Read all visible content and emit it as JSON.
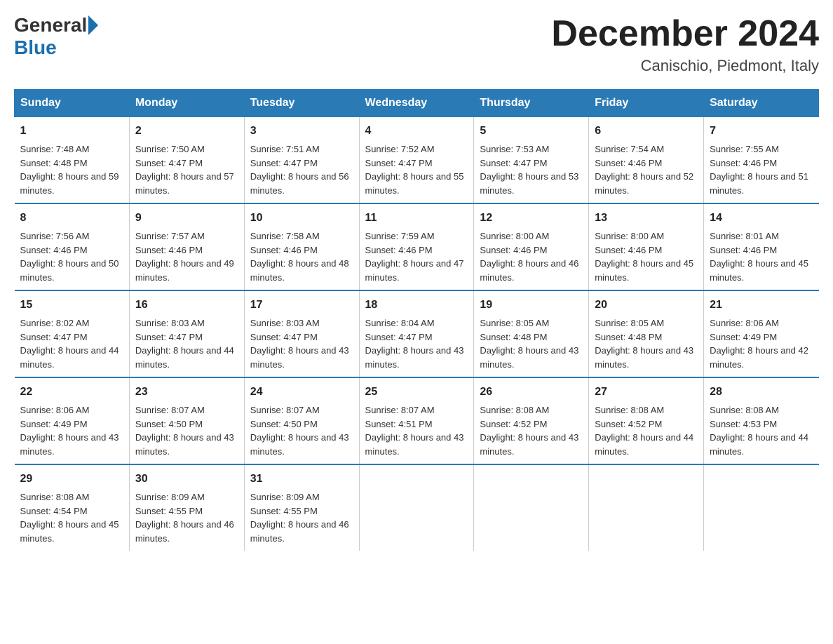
{
  "logo": {
    "general": "General",
    "blue": "Blue"
  },
  "title": {
    "month_year": "December 2024",
    "location": "Canischio, Piedmont, Italy"
  },
  "days_of_week": [
    "Sunday",
    "Monday",
    "Tuesday",
    "Wednesday",
    "Thursday",
    "Friday",
    "Saturday"
  ],
  "weeks": [
    [
      {
        "day": "1",
        "sunrise": "7:48 AM",
        "sunset": "4:48 PM",
        "daylight": "8 hours and 59 minutes."
      },
      {
        "day": "2",
        "sunrise": "7:50 AM",
        "sunset": "4:47 PM",
        "daylight": "8 hours and 57 minutes."
      },
      {
        "day": "3",
        "sunrise": "7:51 AM",
        "sunset": "4:47 PM",
        "daylight": "8 hours and 56 minutes."
      },
      {
        "day": "4",
        "sunrise": "7:52 AM",
        "sunset": "4:47 PM",
        "daylight": "8 hours and 55 minutes."
      },
      {
        "day": "5",
        "sunrise": "7:53 AM",
        "sunset": "4:47 PM",
        "daylight": "8 hours and 53 minutes."
      },
      {
        "day": "6",
        "sunrise": "7:54 AM",
        "sunset": "4:46 PM",
        "daylight": "8 hours and 52 minutes."
      },
      {
        "day": "7",
        "sunrise": "7:55 AM",
        "sunset": "4:46 PM",
        "daylight": "8 hours and 51 minutes."
      }
    ],
    [
      {
        "day": "8",
        "sunrise": "7:56 AM",
        "sunset": "4:46 PM",
        "daylight": "8 hours and 50 minutes."
      },
      {
        "day": "9",
        "sunrise": "7:57 AM",
        "sunset": "4:46 PM",
        "daylight": "8 hours and 49 minutes."
      },
      {
        "day": "10",
        "sunrise": "7:58 AM",
        "sunset": "4:46 PM",
        "daylight": "8 hours and 48 minutes."
      },
      {
        "day": "11",
        "sunrise": "7:59 AM",
        "sunset": "4:46 PM",
        "daylight": "8 hours and 47 minutes."
      },
      {
        "day": "12",
        "sunrise": "8:00 AM",
        "sunset": "4:46 PM",
        "daylight": "8 hours and 46 minutes."
      },
      {
        "day": "13",
        "sunrise": "8:00 AM",
        "sunset": "4:46 PM",
        "daylight": "8 hours and 45 minutes."
      },
      {
        "day": "14",
        "sunrise": "8:01 AM",
        "sunset": "4:46 PM",
        "daylight": "8 hours and 45 minutes."
      }
    ],
    [
      {
        "day": "15",
        "sunrise": "8:02 AM",
        "sunset": "4:47 PM",
        "daylight": "8 hours and 44 minutes."
      },
      {
        "day": "16",
        "sunrise": "8:03 AM",
        "sunset": "4:47 PM",
        "daylight": "8 hours and 44 minutes."
      },
      {
        "day": "17",
        "sunrise": "8:03 AM",
        "sunset": "4:47 PM",
        "daylight": "8 hours and 43 minutes."
      },
      {
        "day": "18",
        "sunrise": "8:04 AM",
        "sunset": "4:47 PM",
        "daylight": "8 hours and 43 minutes."
      },
      {
        "day": "19",
        "sunrise": "8:05 AM",
        "sunset": "4:48 PM",
        "daylight": "8 hours and 43 minutes."
      },
      {
        "day": "20",
        "sunrise": "8:05 AM",
        "sunset": "4:48 PM",
        "daylight": "8 hours and 43 minutes."
      },
      {
        "day": "21",
        "sunrise": "8:06 AM",
        "sunset": "4:49 PM",
        "daylight": "8 hours and 42 minutes."
      }
    ],
    [
      {
        "day": "22",
        "sunrise": "8:06 AM",
        "sunset": "4:49 PM",
        "daylight": "8 hours and 43 minutes."
      },
      {
        "day": "23",
        "sunrise": "8:07 AM",
        "sunset": "4:50 PM",
        "daylight": "8 hours and 43 minutes."
      },
      {
        "day": "24",
        "sunrise": "8:07 AM",
        "sunset": "4:50 PM",
        "daylight": "8 hours and 43 minutes."
      },
      {
        "day": "25",
        "sunrise": "8:07 AM",
        "sunset": "4:51 PM",
        "daylight": "8 hours and 43 minutes."
      },
      {
        "day": "26",
        "sunrise": "8:08 AM",
        "sunset": "4:52 PM",
        "daylight": "8 hours and 43 minutes."
      },
      {
        "day": "27",
        "sunrise": "8:08 AM",
        "sunset": "4:52 PM",
        "daylight": "8 hours and 44 minutes."
      },
      {
        "day": "28",
        "sunrise": "8:08 AM",
        "sunset": "4:53 PM",
        "daylight": "8 hours and 44 minutes."
      }
    ],
    [
      {
        "day": "29",
        "sunrise": "8:08 AM",
        "sunset": "4:54 PM",
        "daylight": "8 hours and 45 minutes."
      },
      {
        "day": "30",
        "sunrise": "8:09 AM",
        "sunset": "4:55 PM",
        "daylight": "8 hours and 46 minutes."
      },
      {
        "day": "31",
        "sunrise": "8:09 AM",
        "sunset": "4:55 PM",
        "daylight": "8 hours and 46 minutes."
      },
      null,
      null,
      null,
      null
    ]
  ]
}
